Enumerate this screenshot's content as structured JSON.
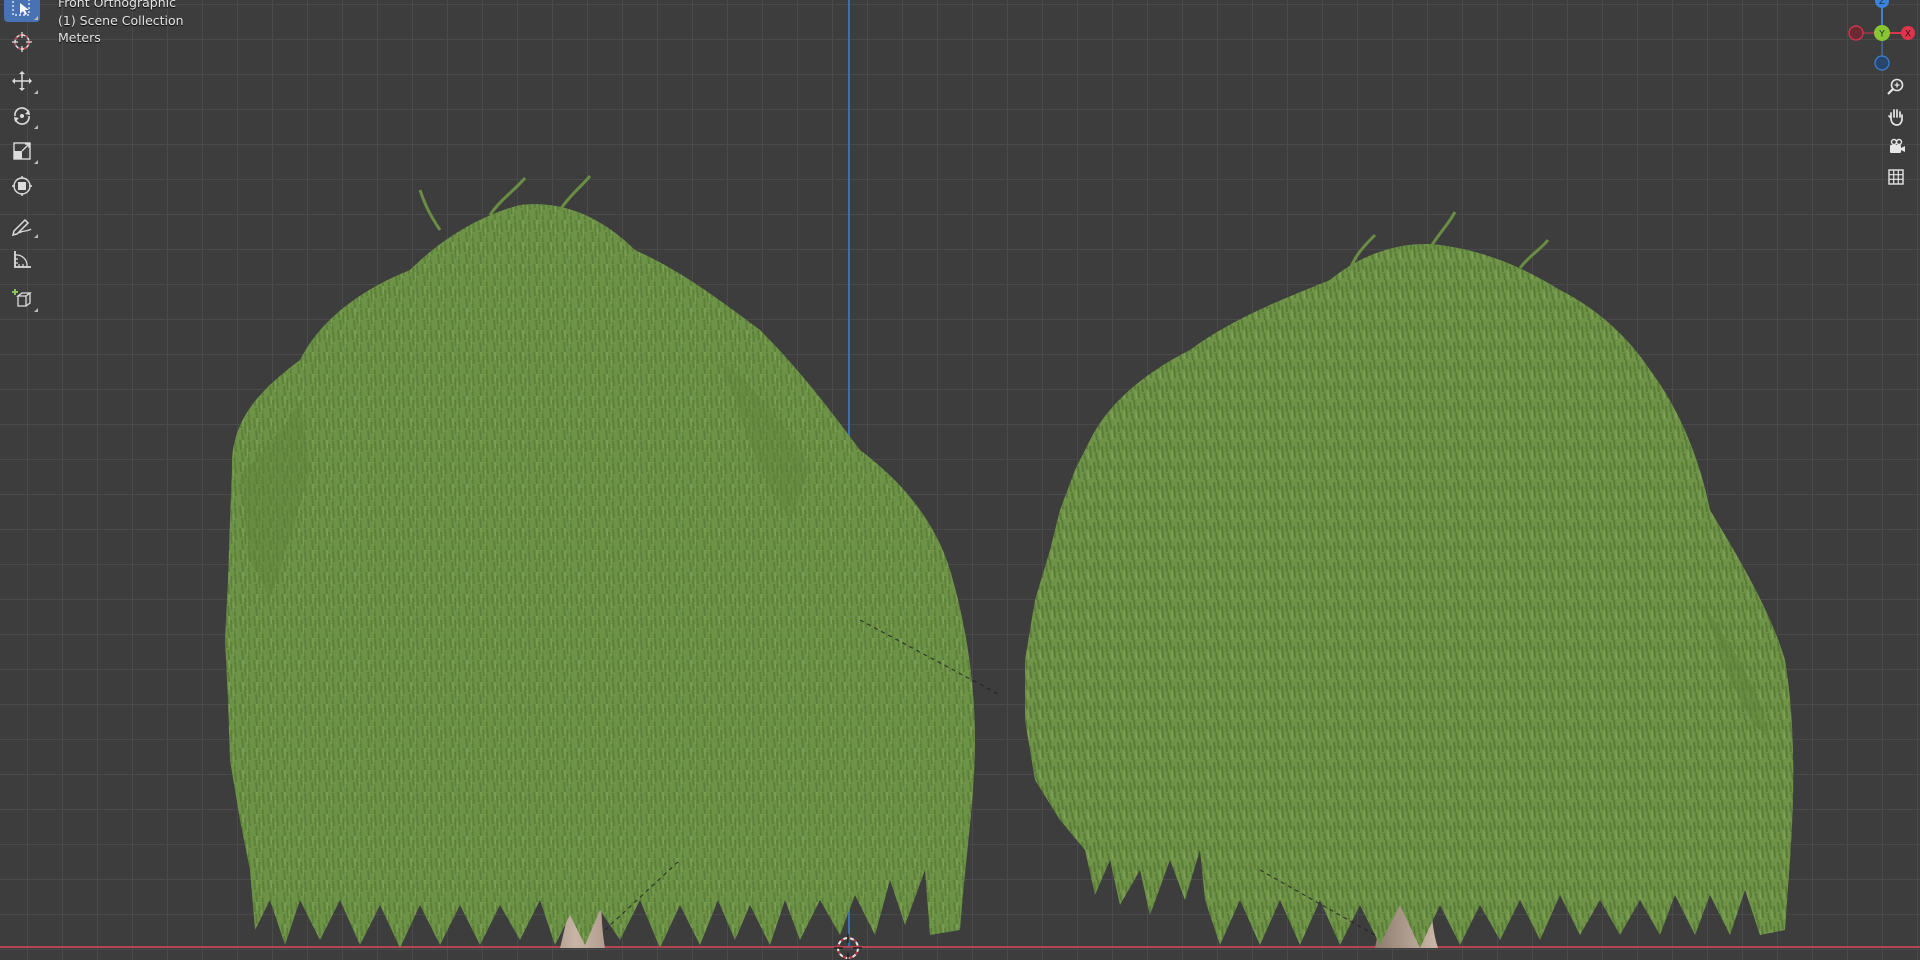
{
  "viewport": {
    "view_name": "Front Orthographic",
    "collection": "(1) Scene Collection",
    "units": "Meters"
  },
  "toolbar": {
    "tools": [
      {
        "name": "select-box",
        "icon": "select-cursor-icon",
        "active": true
      },
      {
        "name": "cursor",
        "icon": "3d-cursor-icon",
        "active": false
      },
      {
        "name": "move",
        "icon": "move-arrows-icon",
        "active": false
      },
      {
        "name": "rotate",
        "icon": "rotate-icon",
        "active": false
      },
      {
        "name": "scale",
        "icon": "scale-icon",
        "active": false
      },
      {
        "name": "transform",
        "icon": "transform-icon",
        "active": false
      },
      {
        "name": "annotate",
        "icon": "pencil-icon",
        "active": false
      },
      {
        "name": "measure",
        "icon": "ruler-icon",
        "active": false
      },
      {
        "name": "add-cube",
        "icon": "add-cube-icon",
        "active": false
      }
    ]
  },
  "gizmo": {
    "axes": {
      "x": "X",
      "y": "Y",
      "z": "Z"
    },
    "colors": {
      "x": "#e0344c",
      "y": "#88c634",
      "z": "#3a83dd"
    }
  },
  "navigation": {
    "buttons": [
      {
        "name": "zoom",
        "icon": "zoom-icon"
      },
      {
        "name": "pan",
        "icon": "hand-icon"
      },
      {
        "name": "camera",
        "icon": "camera-icon"
      },
      {
        "name": "ortho-toggle",
        "icon": "grid-icon"
      }
    ]
  },
  "colors": {
    "background": "#3d3d3d",
    "grid": "#4a4a4a",
    "x_axis": "#b34651",
    "z_axis": "#3a6fb5",
    "foliage": "#6b9146",
    "trunk": "#b8a597",
    "active_tool": "#4772b3"
  }
}
